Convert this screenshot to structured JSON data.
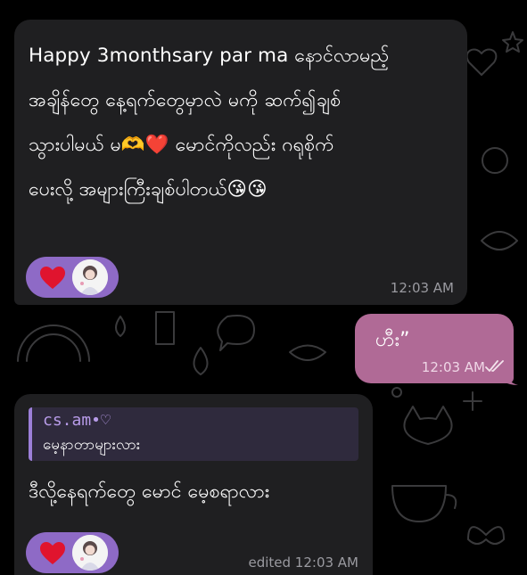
{
  "messages": [
    {
      "direction": "incoming",
      "text": "Happy 3monthsary par ma နောင်လာမည့်\nအချိန်တွေ နေ့ရက်တွေမှာလဲ မကို ဆက်၍ချစ်\nသွားပါမယ် မ🫶❤️ မောင်ကိုလည်း ဂရုစိုက်\nပေးလို့ အများကြီးချစ်ပါတယ်😘😘",
      "time": "12:03 AM",
      "reaction": "heart"
    },
    {
      "direction": "outgoing",
      "text": "ဟီး”",
      "time": "12:03 AM",
      "status": "read"
    },
    {
      "direction": "incoming",
      "reply_to": {
        "name": "cs.am•♡",
        "text": "မေ့နာတာများလား"
      },
      "text": "ဒီလို့နေရက်တွေ မောင် မေ့စရာလား",
      "time": "edited 12:03 AM",
      "reaction": "heart"
    }
  ],
  "colors": {
    "incoming_bubble": "#1f1f21",
    "outgoing_bubble": "#b06a96",
    "reaction_pill": "#8e6ac6",
    "quote_accent": "#9c7fd8"
  }
}
